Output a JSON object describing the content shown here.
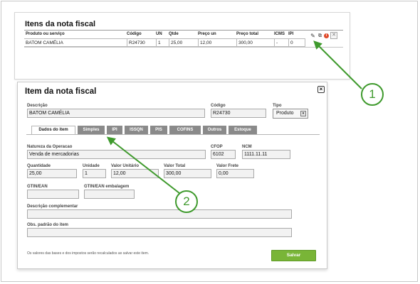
{
  "list_card": {
    "title": "Itens da nota fiscal",
    "columns": [
      "Produto ou serviço",
      "Código",
      "UN",
      "Qtde",
      "Preço un",
      "Preço total",
      "ICMS",
      "IPI"
    ],
    "row": {
      "produto": "BATOM CAMÉLIA",
      "codigo": "R24730",
      "un": "1",
      "qtde": "25,00",
      "preco_un": "12,00",
      "preco_total": "300,00",
      "icms": "-",
      "ipi": "0"
    },
    "row_icons": [
      "edit-icon",
      "copy-icon",
      "info-icon",
      "delete-icon"
    ]
  },
  "modal": {
    "title": "Item da nota fiscal",
    "close_glyph": "×",
    "descricao": {
      "label": "Descrição",
      "value": "BATOM CAMÉLIA"
    },
    "codigo": {
      "label": "Código",
      "value": "R24730"
    },
    "tipo": {
      "label": "Tipo",
      "value": "Produto"
    },
    "tabs": [
      "Dados do item",
      "Simples",
      "IPI",
      "ISSQN",
      "PIS",
      "COFINS",
      "Outros",
      "Estoque"
    ],
    "active_tab": "Dados do item",
    "natureza": {
      "label": "Natureza da Operacao",
      "value": "Venda de mercadorias"
    },
    "cfop": {
      "label": "CFOP",
      "value": "6102"
    },
    "ncm": {
      "label": "NCM",
      "value": "1111.11.11"
    },
    "quantidade": {
      "label": "Quantidade",
      "value": "25,00"
    },
    "unidade": {
      "label": "Unidade",
      "value": "1"
    },
    "valor_unitario": {
      "label": "Valor Unitário",
      "value": "12,00"
    },
    "valor_total": {
      "label": "Valor Total",
      "value": "300,00"
    },
    "valor_frete": {
      "label": "Valor Frete",
      "value": "0,00"
    },
    "gtin": {
      "label": "GTIN/EAN",
      "value": ""
    },
    "gtin_embalagem": {
      "label": "GTIN/EAN embalagem",
      "value": ""
    },
    "descricao_complementar": {
      "label": "Descrição complementar",
      "value": ""
    },
    "obs_padrao": {
      "label": "Obs. padrão do item",
      "value": ""
    },
    "footer_note": "Os valores das bases e dos impostos serão recalculados ao salvar este item.",
    "save_label": "Salvar"
  },
  "annotations": {
    "callout_1": "1",
    "callout_2": "2",
    "color": "#3f9a2d"
  }
}
